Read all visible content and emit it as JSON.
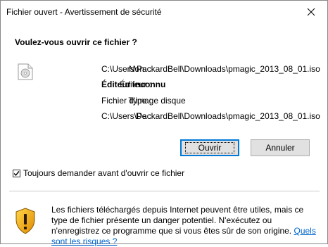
{
  "window": {
    "title": "Fichier ouvert - Avertissement de sécurité",
    "close_icon": "close-icon"
  },
  "question": "Voulez-vous ouvrir ce fichier ?",
  "file": {
    "icon": "iso-file-icon",
    "name_label": "Nom :",
    "name_value": "C:\\Users\\PackardBell\\Downloads\\pmagic_2013_08_01.iso",
    "publisher_label": "Éditeur :",
    "publisher_value": "Éditeur inconnu",
    "type_label": "Type :",
    "type_value": "Fichier d'image disque",
    "from_label": "De :",
    "from_value": "C:\\Users\\PackardBell\\Downloads\\pmagic_2013_08_01.iso"
  },
  "buttons": {
    "open": "Ouvrir",
    "cancel": "Annuler"
  },
  "checkbox": {
    "label": "Toujours demander avant d'ouvrir ce fichier",
    "checked": true
  },
  "warning": {
    "icon": "shield-warning-icon",
    "text": "Les fichiers téléchargés depuis Internet peuvent être utiles, mais ce type de fichier présente un danger potentiel. N'exécutez ou n'enregistrez ce programme que si vous êtes sûr de son origine.",
    "link": "Quels sont les risques ?"
  }
}
